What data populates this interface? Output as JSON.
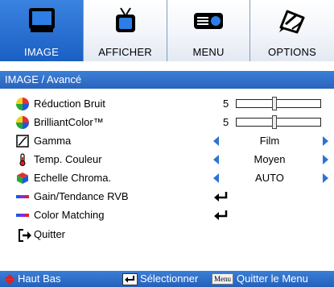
{
  "tabs": [
    {
      "label": "IMAGE",
      "icon": "monitor-icon",
      "active": true
    },
    {
      "label": "AFFICHER",
      "icon": "tv-icon",
      "active": false
    },
    {
      "label": "MENU",
      "icon": "projector-icon",
      "active": false
    },
    {
      "label": "OPTIONS",
      "icon": "pencil-icon",
      "active": false
    }
  ],
  "breadcrumb": "IMAGE / Avancé",
  "rows": [
    {
      "label": "Réduction Bruit",
      "icon": "color-wheel-icon",
      "type": "slider",
      "value": "5",
      "level": 0.45
    },
    {
      "label": "BrilliantColor™",
      "icon": "color-wheel-icon",
      "type": "slider",
      "value": "5",
      "level": 0.45
    },
    {
      "label": "Gamma",
      "icon": "gamma-curve-icon",
      "type": "choice",
      "value": "Film"
    },
    {
      "label": "Temp. Couleur",
      "icon": "thermometer-icon",
      "type": "choice",
      "value": "Moyen"
    },
    {
      "label": "Echelle Chroma.",
      "icon": "color-cube-icon",
      "type": "choice",
      "value": "AUTO"
    },
    {
      "label": "Gain/Tendance RVB",
      "icon": "rgb-bar-icon",
      "type": "enter"
    },
    {
      "label": "Color Matching",
      "icon": "rgb-bar-icon",
      "type": "enter"
    },
    {
      "label": "Quitter",
      "icon": "exit-icon",
      "type": "none"
    }
  ],
  "footer": {
    "nav_label": "Haut Bas",
    "select_label": "Sélectionner",
    "menu_key": "Menu",
    "quit_label": "Quitter le Menu"
  },
  "colors": {
    "accent": "#2b73d4",
    "tab_active": "#1b5fc3",
    "footer": "#2a66c2"
  }
}
